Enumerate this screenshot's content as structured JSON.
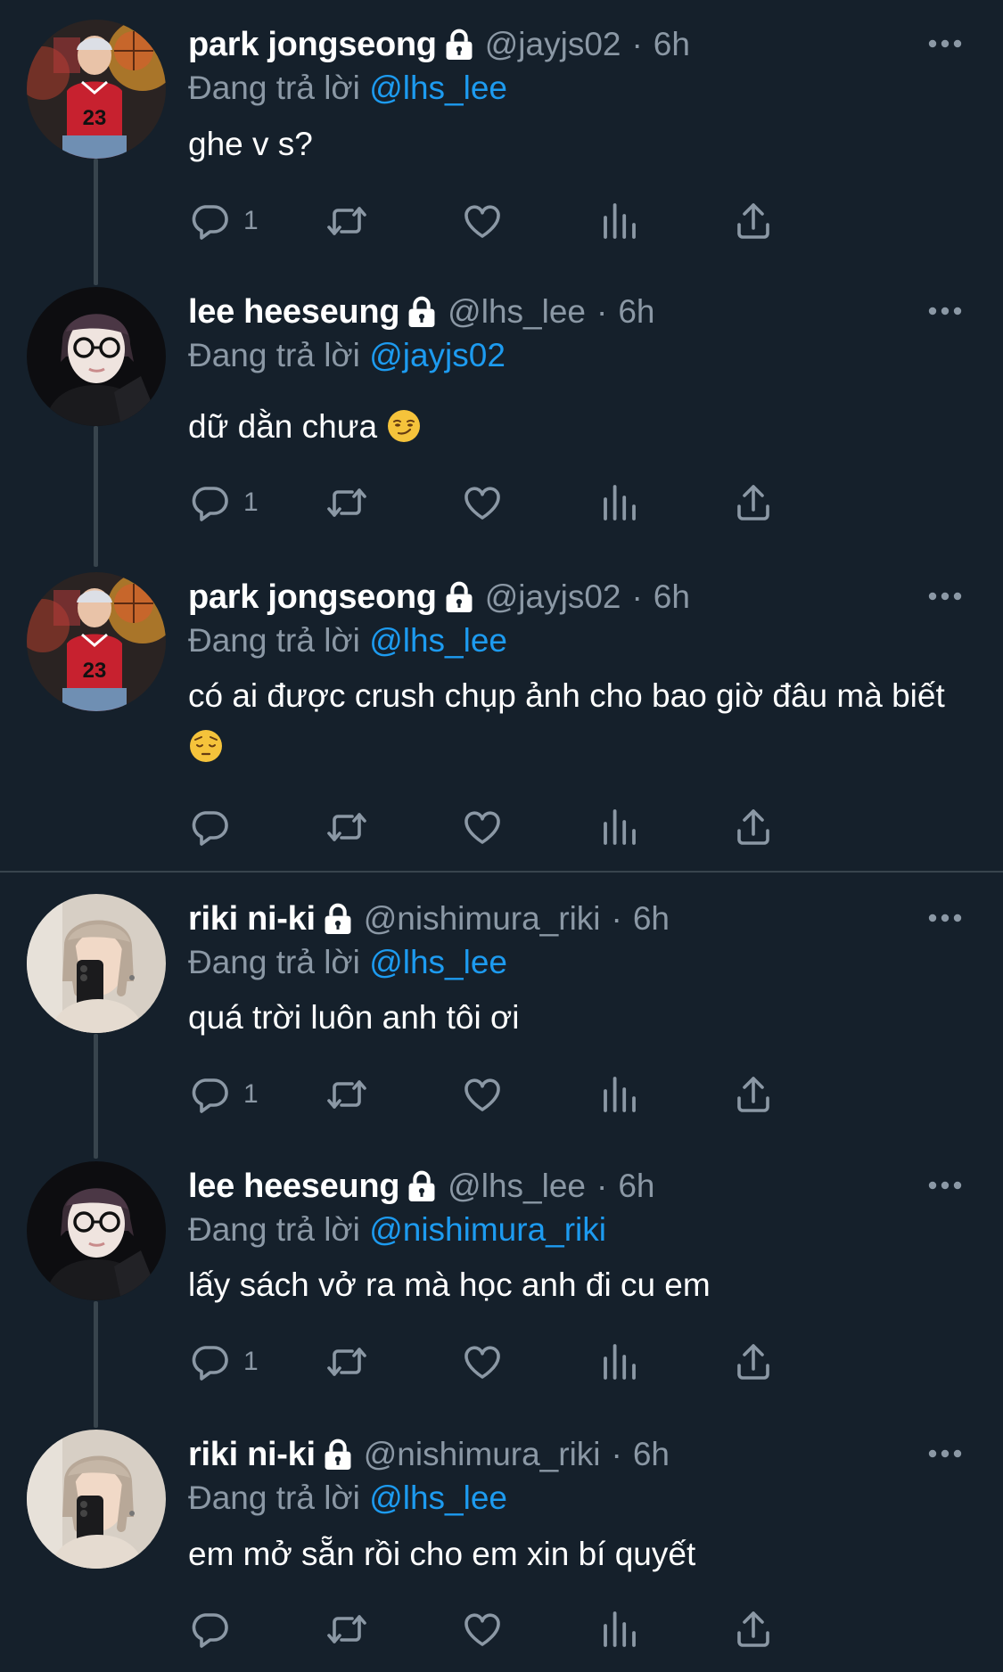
{
  "reply_prefix": "Đang trả lời",
  "time_sep": "·",
  "tweets": [
    {
      "name": "park jongseong",
      "handle": "@jayjs02",
      "time": "6h",
      "reply_to": "@lhs_lee",
      "text": "ghe v s?",
      "emoji": "",
      "reply_count": "1",
      "avatar": "avatar-park-jongseong"
    },
    {
      "name": "lee heeseung",
      "handle": "@lhs_lee",
      "time": "6h",
      "reply_to": "@jayjs02",
      "text": "dữ dằn chưa",
      "emoji": "smirk",
      "reply_count": "1",
      "avatar": "avatar-lee-heeseung"
    },
    {
      "name": "park jongseong",
      "handle": "@jayjs02",
      "time": "6h",
      "reply_to": "@lhs_lee",
      "text": "có ai được crush chụp ảnh cho bao giờ đâu mà biết",
      "emoji": "pensive",
      "reply_count": "",
      "avatar": "avatar-park-jongseong"
    },
    {
      "name": "riki ni-ki",
      "handle": "@nishimura_riki",
      "time": "6h",
      "reply_to": "@lhs_lee",
      "text": "quá trời luôn anh tôi ơi",
      "emoji": "",
      "reply_count": "1",
      "avatar": "avatar-riki-ni-ki"
    },
    {
      "name": "lee heeseung",
      "handle": "@lhs_lee",
      "time": "6h",
      "reply_to": "@nishimura_riki",
      "text": "lấy sách vở ra mà học anh đi cu em",
      "emoji": "",
      "reply_count": "1",
      "avatar": "avatar-lee-heeseung"
    },
    {
      "name": "riki ni-ki",
      "handle": "@nishimura_riki",
      "time": "6h",
      "reply_to": "@lhs_lee",
      "text": "em mở sẵn rồi cho em xin bí quyết",
      "emoji": "",
      "reply_count": "",
      "avatar": "avatar-riki-ni-ki"
    }
  ],
  "icons": {
    "lock": "lock-icon",
    "more": "more-icon",
    "reply": "reply-icon",
    "retweet": "retweet-icon",
    "like": "like-icon",
    "views": "views-icon",
    "share": "share-icon"
  },
  "colors": {
    "background": "#15202b",
    "text": "#ffffff",
    "muted": "#8b98a5",
    "mention": "#1d9bf0",
    "line": "#38444d"
  }
}
